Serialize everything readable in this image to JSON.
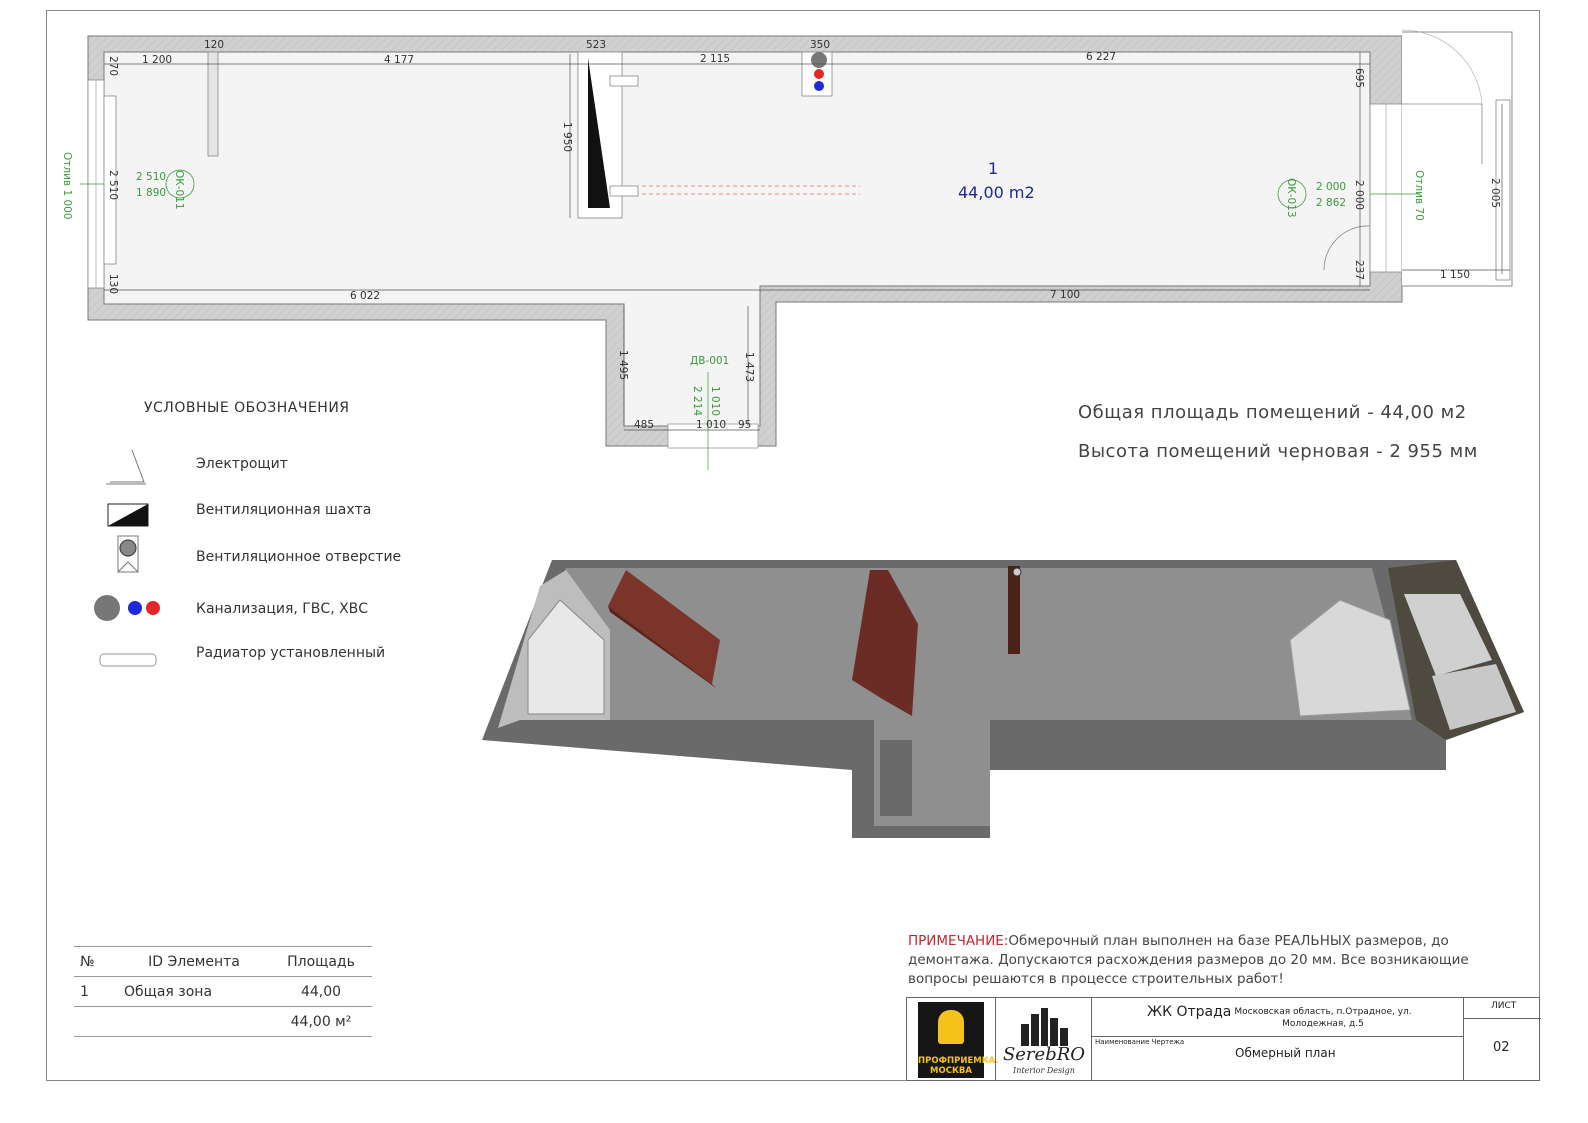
{
  "plan": {
    "room_number": "1",
    "room_area": "44,00 m2",
    "dimensions": {
      "top_1200": "1 200",
      "top_120": "120",
      "top_4177": "4 177",
      "top_523": "523",
      "top_2115": "2 115",
      "top_350": "350",
      "top_6227": "6 227",
      "left_270": "270",
      "left_130": "130",
      "left_2510a": "2 510",
      "left_2510b": "2 510",
      "left_1890": "1 890",
      "mid_1950": "1 950",
      "right_695": "695",
      "right_237": "237",
      "right_2000a": "2 000",
      "right_2000b": "2 000",
      "right_2862": "2 862",
      "ext_2005": "2 005",
      "ext_1150": "1 150",
      "bot_6022": "6 022",
      "bot_7100": "7 100",
      "cor_1495": "1 495",
      "cor_1473": "1 473",
      "cor_485": "485",
      "cor_1010": "1 010",
      "cor_95": "95",
      "door_1010": "1 010",
      "door_2214": "2 214"
    },
    "tags": {
      "window_left": "ОК-011",
      "window_right": "ОК-013",
      "door": "ДВ-001",
      "sill_left": "Отлив 1 000",
      "sill_right": "Отлив 70"
    }
  },
  "legend": {
    "title": "УСЛОВНЫЕ ОБОЗНАЧЕНИЯ",
    "items": [
      {
        "label": "Электрощит",
        "icon": "electric-panel-icon"
      },
      {
        "label": "Вентиляционная шахта",
        "icon": "ventilation-shaft-icon"
      },
      {
        "label": "Вентиляционное отверстие",
        "icon": "ventilation-hole-icon"
      },
      {
        "label": "Канализация, ГВС, ХВС",
        "icon": "sewer-hot-cold-water-icon"
      },
      {
        "label": "Радиатор установленный",
        "icon": "radiator-icon"
      }
    ]
  },
  "summary": {
    "total_area": "Общая площадь помещений  - 44,00 м2",
    "height": "Высота помещений черновая - 2 955 мм"
  },
  "note": {
    "prefix": "ПРИМЕЧАНИЕ:",
    "text": "Обмерочный план выполнен на базе РЕАЛЬНЫХ размеров, до демонтажа. Допускаются расхождения размеров до 20 мм. Все возникающие вопросы решаются в процессе строительных работ!"
  },
  "rooms_table": {
    "headers": [
      "№",
      "ID Элемента",
      "Площадь"
    ],
    "rows": [
      [
        "1",
        "Общая зона",
        "44,00"
      ]
    ],
    "total": "44,00 м²"
  },
  "stamp": {
    "logo1_text": "ПРОФПРИЕМКА. МОСКВА",
    "logo2_name": "SerebRO",
    "logo2_sub": "Interior Design",
    "project": "ЖК Отрада",
    "address": "Московская область, п.Отрадное, ул. Молодежная, д.5",
    "drawing_caption": "Наименование Чертежа",
    "drawing_name": "Обмерный план",
    "sheet_caption": "ЛИСТ",
    "sheet_number": "02"
  },
  "colors": {
    "wall": "#cfcfcf",
    "dim_green": "#3a9a3a",
    "room_blue": "#1d2a8c",
    "brick": "#7a342a",
    "note_red": "#c2272d",
    "hot": "#e32626",
    "cold": "#1f2bd9"
  }
}
